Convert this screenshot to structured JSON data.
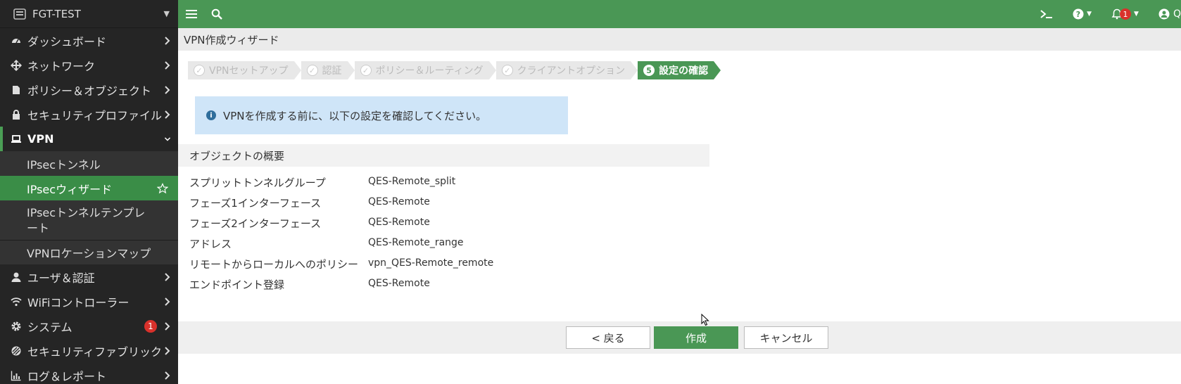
{
  "device": {
    "name": "FGT-TEST"
  },
  "sidebar": {
    "items": [
      {
        "label": "ダッシュボード",
        "icon": "dashboard-icon"
      },
      {
        "label": "ネットワーク",
        "icon": "network-icon"
      },
      {
        "label": "ポリシー＆オブジェクト",
        "icon": "policy-icon"
      },
      {
        "label": "セキュリティプロファイル",
        "icon": "lock-icon"
      },
      {
        "label": "VPN",
        "icon": "laptop-icon"
      }
    ],
    "vpn_sub": [
      {
        "label": "IPsecトンネル"
      },
      {
        "label": "IPsecウィザード"
      },
      {
        "label": "IPsecトンネルテンプレート"
      },
      {
        "label": "VPNロケーションマップ"
      }
    ],
    "items_after": [
      {
        "label": "ユーザ＆認証",
        "icon": "user-icon"
      },
      {
        "label": "WiFiコントローラー",
        "icon": "wifi-icon"
      },
      {
        "label": "システム",
        "icon": "gear-icon",
        "badge": "1"
      },
      {
        "label": "セキュリティファブリック",
        "icon": "fabric-icon"
      },
      {
        "label": "ログ＆レポート",
        "icon": "chart-icon"
      }
    ]
  },
  "topbar": {
    "notification_count": "1",
    "user_initial": "Q"
  },
  "page": {
    "title": "VPN作成ウィザード"
  },
  "wizard": {
    "steps": [
      {
        "label": "VPNセットアップ",
        "state": "done"
      },
      {
        "label": "認証",
        "state": "done"
      },
      {
        "label": "ポリシー＆ルーティング",
        "state": "done"
      },
      {
        "label": "クライアントオプション",
        "state": "done"
      },
      {
        "label": "設定の確認",
        "state": "active",
        "number": "5"
      }
    ]
  },
  "info": {
    "text": "VPNを作成する前に、以下の設定を確認してください。"
  },
  "summary": {
    "header": "オブジェクトの概要",
    "rows": [
      {
        "key": "スプリットトンネルグループ",
        "value": "QES-Remote_split"
      },
      {
        "key": "フェーズ1インターフェース",
        "value": "QES-Remote"
      },
      {
        "key": "フェーズ2インターフェース",
        "value": "QES-Remote"
      },
      {
        "key": "アドレス",
        "value": "QES-Remote_range"
      },
      {
        "key": "リモートからローカルへのポリシー",
        "value": "vpn_QES-Remote_remote"
      },
      {
        "key": "エンドポイント登録",
        "value": "QES-Remote"
      }
    ]
  },
  "buttons": {
    "back": "< 戻る",
    "create": "作成",
    "cancel": "キャンセル"
  },
  "colors": {
    "brand_green": "#4a9755",
    "sidebar_bg": "#252525",
    "info_bg": "#cfe5f8",
    "badge_red": "#d9312b"
  }
}
